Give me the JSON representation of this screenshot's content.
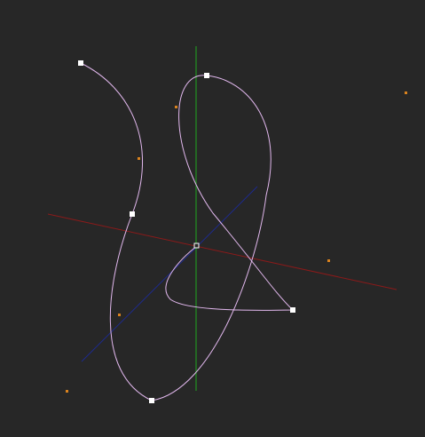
{
  "viewport": {
    "background": "#272727"
  },
  "axes": {
    "x_axis_color": "#8b1a1a",
    "y_axis_color": "#1faa1f",
    "z_axis_color": "#1e2a8c"
  },
  "curve": {
    "stroke_color": "#e2b8ee",
    "control_point_color": "#ffffff",
    "handle_point_color": "#d9821e",
    "origin_marker": "origin-point",
    "control_point_count": 6,
    "handle_point_count": 6
  }
}
